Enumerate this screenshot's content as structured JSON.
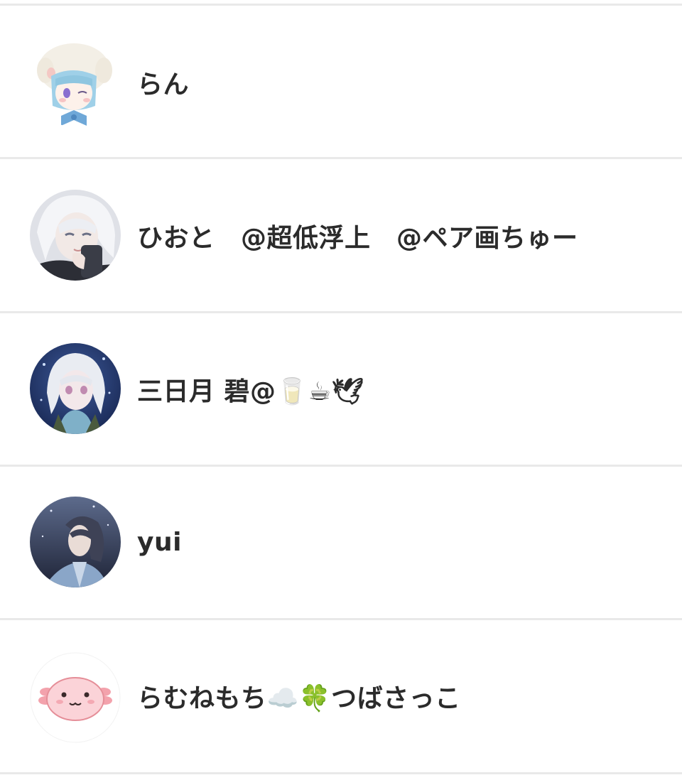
{
  "users": [
    {
      "name": "らん",
      "avatar": "avatar-chibi-bunny-hood-icon"
    },
    {
      "name": "ひおと　@超低浮上　@ペア画ちゅー",
      "avatar": "avatar-white-hair-phone-icon"
    },
    {
      "name": "三日月 碧@🥛☕🕊",
      "avatar": "avatar-white-hair-night-icon"
    },
    {
      "name": "yui",
      "avatar": "avatar-dark-hair-starry-icon"
    },
    {
      "name": "らむねもち☁️🍀つばさっこ",
      "avatar": "avatar-axolotl-icon"
    }
  ],
  "colors": {
    "divider": "#e9e9e9",
    "text": "#2b2b2b",
    "background": "#ffffff"
  }
}
